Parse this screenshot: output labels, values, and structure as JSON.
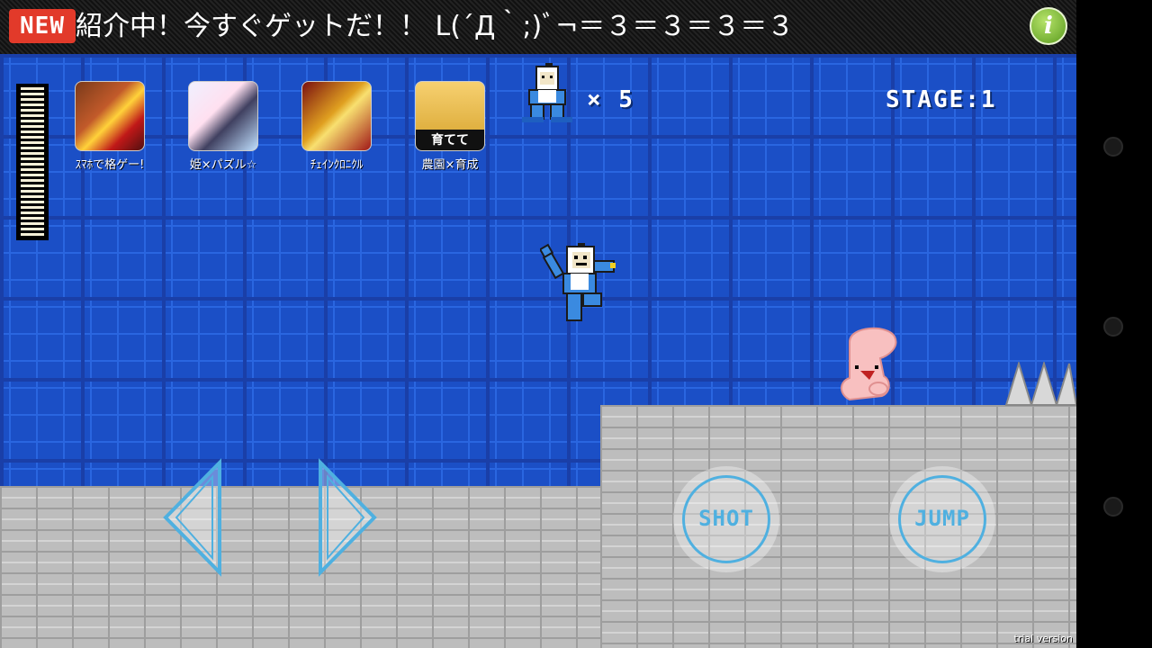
{
  "banner": {
    "badge": "NEW",
    "text": "紹介中！今すぐゲットだ！！ L(´Д｀;)ﾞ¬＝３＝３＝３＝３"
  },
  "info_button": {
    "icon": "info-icon",
    "label": "i"
  },
  "hud": {
    "health_segments": 28,
    "lives_text": "× 5",
    "stage_text": "STAGE:1"
  },
  "apps": [
    {
      "label": "ｽﾏﾎで格ゲー!",
      "icon": "fighting-game-app-icon"
    },
    {
      "label": "姫×パズル☆",
      "icon": "princess-puzzle-app-icon"
    },
    {
      "label": "ﾁｪｲﾝｸﾛﾆｸﾙ",
      "icon": "chain-chronicle-app-icon"
    },
    {
      "label": "農園×育成",
      "icon": "farm-raising-app-icon",
      "caption": "育てて"
    }
  ],
  "controls": {
    "shot_label": "SHOT",
    "jump_label": "JUMP"
  },
  "footer": {
    "trial": "trial version"
  },
  "colors": {
    "sky": "#1b4fc6",
    "ground": "#bdbdbd",
    "button_accent": "#4fb0e0",
    "badge": "#e23a2a"
  }
}
